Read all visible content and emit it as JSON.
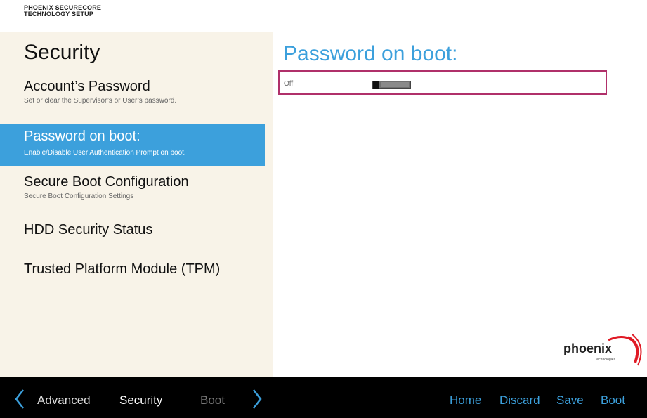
{
  "brand": {
    "line1": "PHOENIX SECURECORE",
    "line2": "TECHNOLOGY SETUP"
  },
  "sidebar": {
    "title": "Security",
    "items": [
      {
        "label": "Account’s Password",
        "desc": "Set or clear the Supervisor’s or User’s password."
      },
      {
        "label": "Password on boot:",
        "desc": "Enable/Disable User Authentication Prompt on boot."
      },
      {
        "label": "Secure Boot Configuration",
        "desc": "Secure Boot Configuration Settings"
      },
      {
        "label": "HDD Security Status",
        "desc": ""
      },
      {
        "label": "Trusted Platform Module (TPM)",
        "desc": ""
      }
    ],
    "active_index": 1
  },
  "panel": {
    "title": "Password on boot:",
    "setting": {
      "value_label": "Off",
      "toggle_state": "off"
    }
  },
  "logo": {
    "text": "phoenix",
    "sub": "technologies"
  },
  "footer": {
    "tabs": [
      {
        "label": "Advanced"
      },
      {
        "label": "Security"
      },
      {
        "label": "Boot"
      }
    ],
    "actions": [
      {
        "label": "Home"
      },
      {
        "label": "Discard"
      },
      {
        "label": "Save"
      },
      {
        "label": "Boot"
      }
    ]
  },
  "colors": {
    "accent": "#3ca0dc",
    "sidebar_bg": "#f8f3e8",
    "focus_border": "#b0306a",
    "footer_bg": "#000000"
  }
}
